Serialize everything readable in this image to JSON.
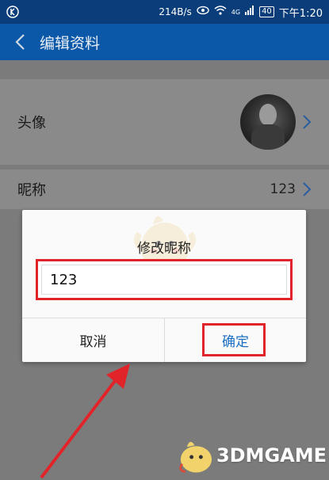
{
  "status_bar": {
    "network_speed": "214B/s",
    "signal_label": "4G",
    "battery": "40",
    "time": "下午1:20"
  },
  "header": {
    "title": "编辑资料"
  },
  "profile": {
    "avatar_label": "头像",
    "nickname_label": "昵称",
    "nickname_value": "123"
  },
  "dialog": {
    "title": "修改昵称",
    "input_value": "123",
    "cancel_label": "取消",
    "confirm_label": "确定"
  },
  "watermark": {
    "text": "3DMGAME"
  },
  "colors": {
    "header_blue": "#0b58a8",
    "status_blue": "#0a3d7a",
    "highlight_red": "#e0242a",
    "confirm_blue": "#1a6fc2"
  }
}
